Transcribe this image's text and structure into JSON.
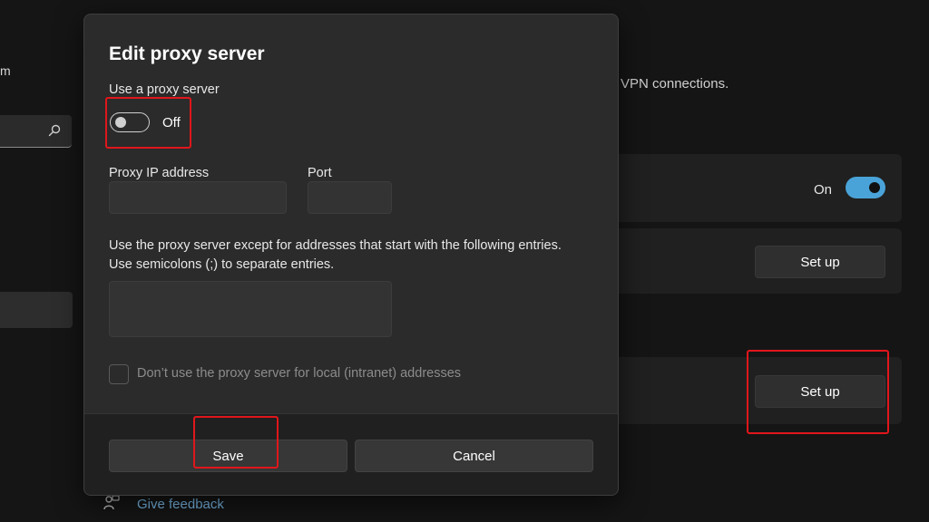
{
  "background": {
    "left_fragment": "m",
    "description_fragment": "VPN connections.",
    "toggle_state_label": "On",
    "setup_button_1": "Set up",
    "setup_button_2": "Set up",
    "feedback_link": "Give feedback"
  },
  "dialog": {
    "title": "Edit proxy server",
    "use_proxy_label": "Use a proxy server",
    "use_proxy_state": "Off",
    "proxy_ip_label": "Proxy IP address",
    "proxy_ip_value": "",
    "port_label": "Port",
    "port_value": "",
    "exceptions_line1": "Use the proxy server except for addresses that start with the following entries.",
    "exceptions_line2": "Use semicolons (;) to separate entries.",
    "exceptions_value": "",
    "local_bypass_label": "Don’t use the proxy server for local (intranet) addresses",
    "save_label": "Save",
    "cancel_label": "Cancel"
  },
  "colors": {
    "accent": "#4aa3d8",
    "annotation": "#e0161b",
    "link": "#79b8e6"
  },
  "icons": [
    "search-icon",
    "feedback-icon"
  ]
}
